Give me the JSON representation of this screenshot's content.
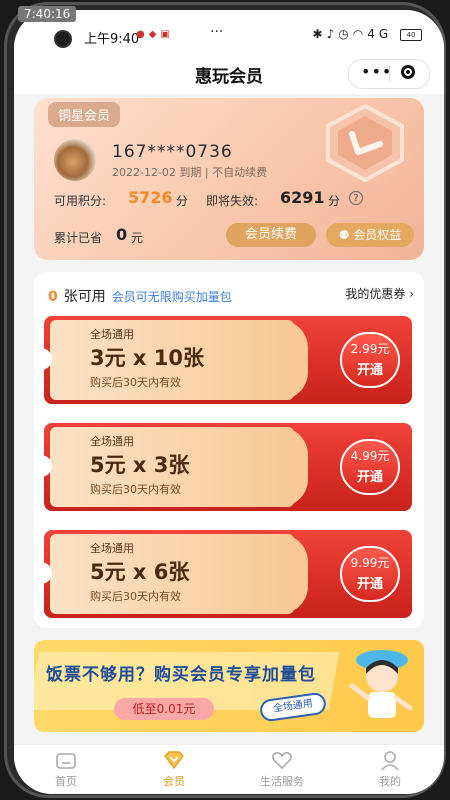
{
  "status": {
    "recording": "7:40:16",
    "time": "上午9:40",
    "signal": "4G",
    "battery": "40"
  },
  "nav": {
    "title": "惠玩会员",
    "more": "•••"
  },
  "member": {
    "tier": "铜星会员",
    "phone": "167****0736",
    "expire": "2022-12-02 到期 | 不自动续费",
    "points_label": "可用积分:",
    "points_value": "5726",
    "points_unit": "分",
    "expiring_label": "即将失效:",
    "expiring_value": "6291",
    "expiring_unit": "分",
    "saved_label": "累计已省",
    "saved_value": "0",
    "saved_unit": "元",
    "renew_btn": "会员续费",
    "rights_btn": "会员权益",
    "help": "?"
  },
  "coupons": {
    "available_count": "0",
    "available_label": "张可用",
    "note": "会员可无限购买加量包",
    "my_coupons": "我的优惠券",
    "items": [
      {
        "scope": "全场通用",
        "title": "3元 x 10张",
        "valid": "购买后30天内有效",
        "price": "2.99元",
        "action": "开通"
      },
      {
        "scope": "全场通用",
        "title": "5元 x 3张",
        "valid": "购买后30天内有效",
        "price": "4.99元",
        "action": "开通"
      },
      {
        "scope": "全场通用",
        "title": "5元 x 6张",
        "valid": "购买后30天内有效",
        "price": "9.99元",
        "action": "开通"
      }
    ]
  },
  "banner": {
    "title": "饭票不够用？购买会员专享加量包",
    "pill": "低至0.01元",
    "tag": "全场通用"
  },
  "tabs": [
    {
      "label": "首页",
      "icon": "home-icon"
    },
    {
      "label": "会员",
      "icon": "member-icon"
    },
    {
      "label": "生活服务",
      "icon": "heart-icon"
    },
    {
      "label": "我的",
      "icon": "user-icon"
    }
  ],
  "colors": {
    "accent": "#f08a2a",
    "coupon_red": "#e23a30",
    "tab_active": "#d99a25",
    "link_blue": "#3b7fd8"
  }
}
